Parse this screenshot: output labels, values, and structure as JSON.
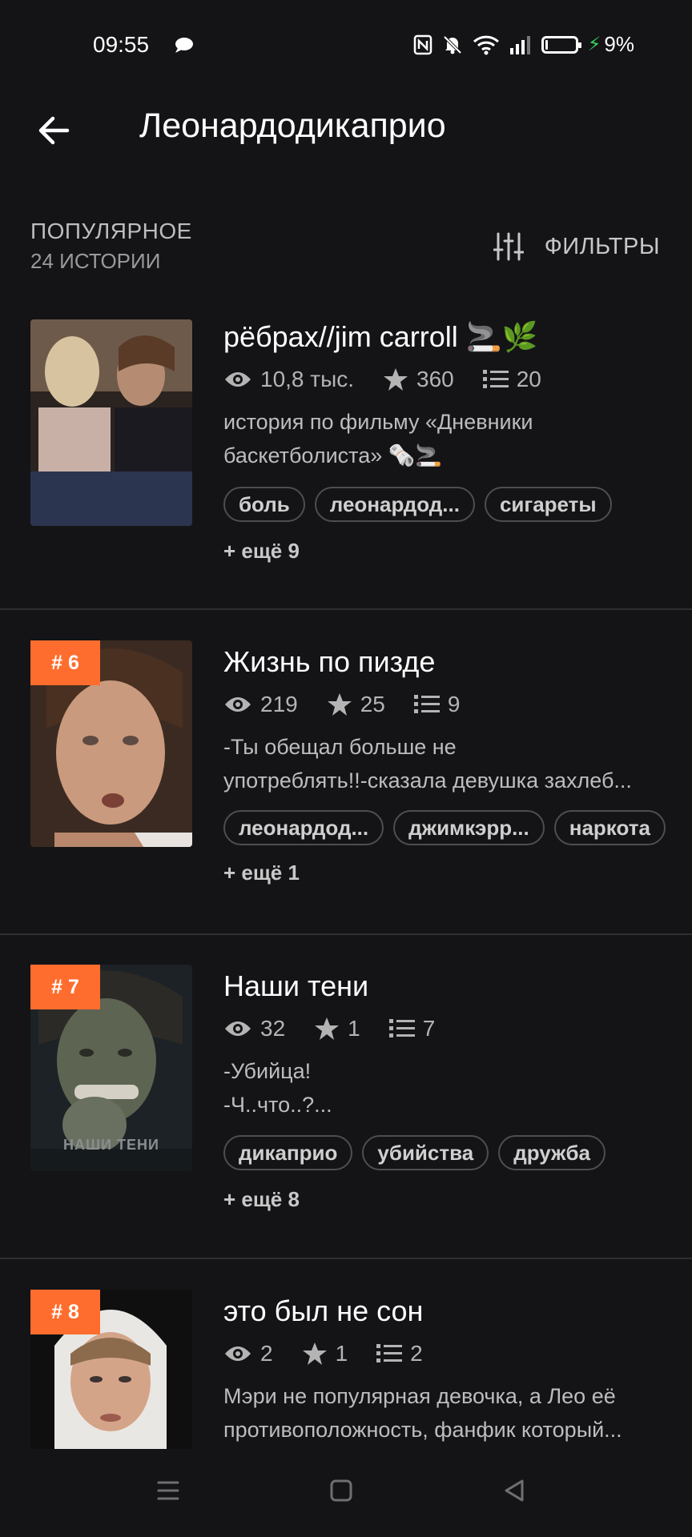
{
  "status": {
    "time": "09:55",
    "battery": "9%"
  },
  "header": {
    "title": "Леонардодикаприо"
  },
  "section": {
    "title": "ПОПУЛЯРНОЕ",
    "subtitle": "24 ИСТОРИИ",
    "filters_label": "ФИЛЬТРЫ"
  },
  "stories": [
    {
      "rank": "",
      "title": "рёбрах//jim carroll 🚬🌿",
      "views": "10,8 тыс.",
      "stars": "360",
      "chapters": "20",
      "desc_lines": [
        "история по фильму «Дневники",
        "баскетболиста» 🗞️🚬"
      ],
      "tags": [
        "боль",
        "леонардод...",
        "сигареты"
      ],
      "more": "+ ещё 9"
    },
    {
      "rank": "# 6",
      "title": "Жизнь по пизде",
      "views": "219",
      "stars": "25",
      "chapters": "9",
      "desc_lines": [
        "-Ты обещал больше не",
        "употреблять!!-сказала девушка захлеб..."
      ],
      "tags": [
        "леонардод...",
        "джимкэрр...",
        "наркота"
      ],
      "more": "+ ещё 1"
    },
    {
      "rank": "# 7",
      "title": "Наши тени",
      "views": "32",
      "stars": "1",
      "chapters": "7",
      "desc_lines": [
        "-Убийца!",
        "-Ч..что..?..."
      ],
      "tags": [
        "дикаприо",
        "убийства",
        "дружба"
      ],
      "more": "+ ещё 8",
      "cover_text": "НАШИ  ТЕНИ"
    },
    {
      "rank": "# 8",
      "title": "это был не сон",
      "views": "2",
      "stars": "1",
      "chapters": "2",
      "desc_lines": [
        "Мэри не популярная девочка, а Лео её",
        "противоположность, фанфик который..."
      ],
      "tags": [],
      "more": ""
    }
  ],
  "colors": {
    "background": "#141316",
    "accent": "#ff6d2e",
    "divider": "#2e2d31",
    "tag_border": "#4e4d51"
  }
}
